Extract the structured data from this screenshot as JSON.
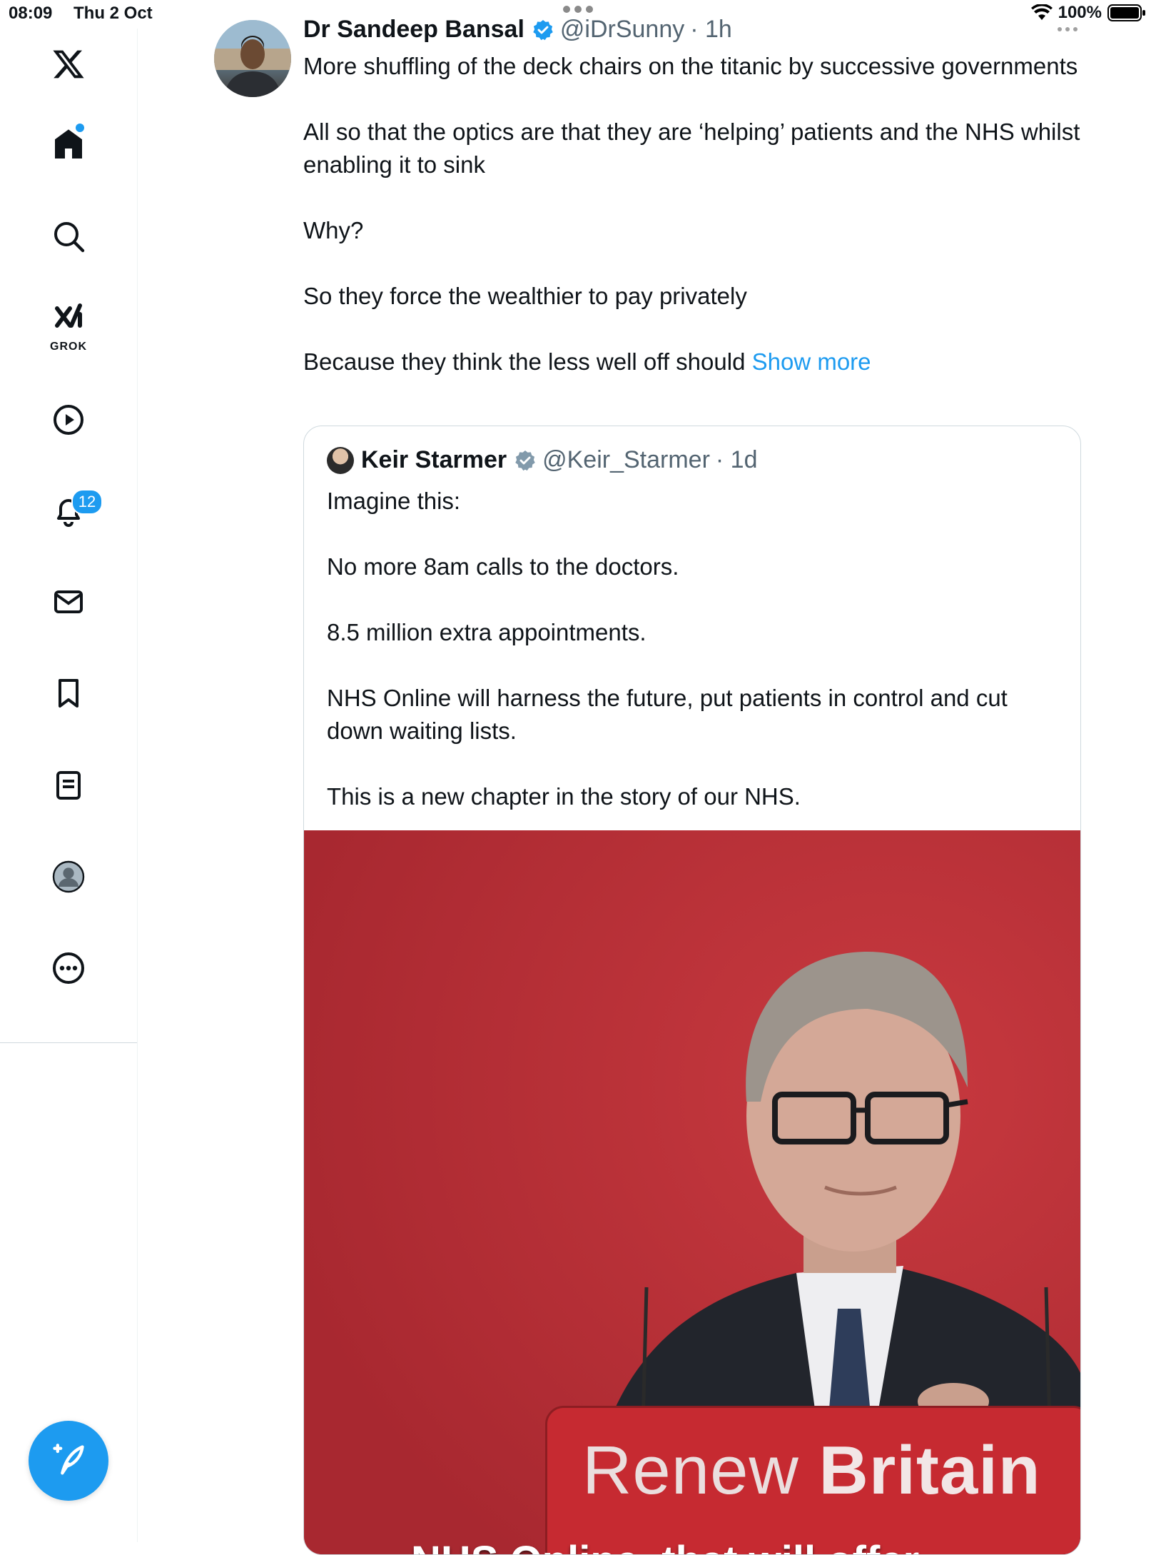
{
  "status_bar": {
    "time": "08:09",
    "date": "Thu 2 Oct",
    "battery": "100%"
  },
  "sidebar": {
    "items": [
      {
        "name": "x-logo-icon"
      },
      {
        "name": "home-icon"
      },
      {
        "name": "search-icon"
      },
      {
        "name": "grok-icon",
        "label": "GROK"
      },
      {
        "name": "video-icon"
      },
      {
        "name": "notifications-icon",
        "badge": "12"
      },
      {
        "name": "messages-icon"
      },
      {
        "name": "bookmarks-icon"
      },
      {
        "name": "lists-icon"
      },
      {
        "name": "profile-icon"
      },
      {
        "name": "more-icon"
      }
    ],
    "compose_icon": "compose-icon"
  },
  "tweet": {
    "author": "Dr Sandeep Bansal",
    "handle": "@iDrSunny",
    "time": "· 1h",
    "lines": [
      "More shuffling of the deck chairs on the titanic by successive governments",
      "All so that the optics are that they are ‘helping’ patients and the NHS whilst enabling it to sink",
      "Why?",
      "So they force the wealthier to pay privately",
      "Because they think the less well off should"
    ],
    "show_more": "Show more"
  },
  "quote": {
    "author": "Keir Starmer",
    "handle": "@Keir_Starmer",
    "time": "· 1d",
    "lines": [
      "Imagine this:",
      "No more 8am calls to the doctors.",
      "8.5 million extra appointments.",
      "NHS Online will harness the future, put patients in control and cut down waiting lists.",
      "This is a new chapter in the story of our NHS."
    ],
    "media": {
      "banner_word1": "Renew",
      "banner_word2": "Britain",
      "caption": "NHS Online, that will offer"
    }
  },
  "colors": {
    "accent": "#1d9bf0",
    "media_red": "#b72e34",
    "secondary_text": "#536471"
  }
}
